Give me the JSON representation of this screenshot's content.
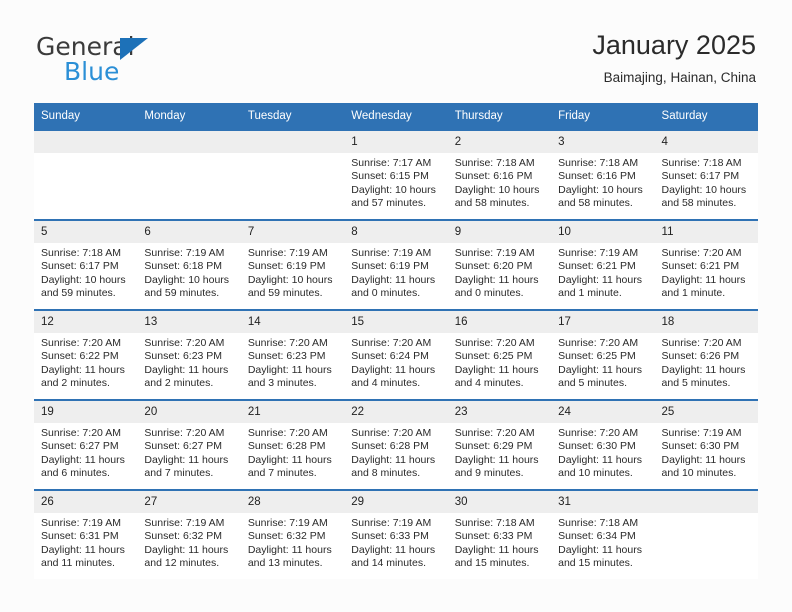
{
  "brand": {
    "name_part1": "General",
    "name_part2": "Blue",
    "accent_color": "#2b8fd6",
    "triangle_color": "#1d71b8",
    "logo_icon": "triangle-icon"
  },
  "header": {
    "title": "January 2025",
    "subtitle": "Baimajing, Hainan, China"
  },
  "theme": {
    "header_row_bg": "#2f72b4",
    "daynum_bg": "#eeeeee",
    "page_bg": "#fcfcfc",
    "text_color": "#2a2a2a"
  },
  "weekdays": [
    "Sunday",
    "Monday",
    "Tuesday",
    "Wednesday",
    "Thursday",
    "Friday",
    "Saturday"
  ],
  "labels": {
    "sunrise_prefix": "Sunrise:",
    "sunset_prefix": "Sunset:",
    "daylight_prefix": "Daylight:"
  },
  "weeks": [
    [
      {
        "day": "",
        "empty": true
      },
      {
        "day": "",
        "empty": true
      },
      {
        "day": "",
        "empty": true
      },
      {
        "day": "1",
        "sunrise": "Sunrise: 7:17 AM",
        "sunset": "Sunset: 6:15 PM",
        "daylight": "Daylight: 10 hours and 57 minutes."
      },
      {
        "day": "2",
        "sunrise": "Sunrise: 7:18 AM",
        "sunset": "Sunset: 6:16 PM",
        "daylight": "Daylight: 10 hours and 58 minutes."
      },
      {
        "day": "3",
        "sunrise": "Sunrise: 7:18 AM",
        "sunset": "Sunset: 6:16 PM",
        "daylight": "Daylight: 10 hours and 58 minutes."
      },
      {
        "day": "4",
        "sunrise": "Sunrise: 7:18 AM",
        "sunset": "Sunset: 6:17 PM",
        "daylight": "Daylight: 10 hours and 58 minutes."
      }
    ],
    [
      {
        "day": "5",
        "sunrise": "Sunrise: 7:18 AM",
        "sunset": "Sunset: 6:17 PM",
        "daylight": "Daylight: 10 hours and 59 minutes."
      },
      {
        "day": "6",
        "sunrise": "Sunrise: 7:19 AM",
        "sunset": "Sunset: 6:18 PM",
        "daylight": "Daylight: 10 hours and 59 minutes."
      },
      {
        "day": "7",
        "sunrise": "Sunrise: 7:19 AM",
        "sunset": "Sunset: 6:19 PM",
        "daylight": "Daylight: 10 hours and 59 minutes."
      },
      {
        "day": "8",
        "sunrise": "Sunrise: 7:19 AM",
        "sunset": "Sunset: 6:19 PM",
        "daylight": "Daylight: 11 hours and 0 minutes."
      },
      {
        "day": "9",
        "sunrise": "Sunrise: 7:19 AM",
        "sunset": "Sunset: 6:20 PM",
        "daylight": "Daylight: 11 hours and 0 minutes."
      },
      {
        "day": "10",
        "sunrise": "Sunrise: 7:19 AM",
        "sunset": "Sunset: 6:21 PM",
        "daylight": "Daylight: 11 hours and 1 minute."
      },
      {
        "day": "11",
        "sunrise": "Sunrise: 7:20 AM",
        "sunset": "Sunset: 6:21 PM",
        "daylight": "Daylight: 11 hours and 1 minute."
      }
    ],
    [
      {
        "day": "12",
        "sunrise": "Sunrise: 7:20 AM",
        "sunset": "Sunset: 6:22 PM",
        "daylight": "Daylight: 11 hours and 2 minutes."
      },
      {
        "day": "13",
        "sunrise": "Sunrise: 7:20 AM",
        "sunset": "Sunset: 6:23 PM",
        "daylight": "Daylight: 11 hours and 2 minutes."
      },
      {
        "day": "14",
        "sunrise": "Sunrise: 7:20 AM",
        "sunset": "Sunset: 6:23 PM",
        "daylight": "Daylight: 11 hours and 3 minutes."
      },
      {
        "day": "15",
        "sunrise": "Sunrise: 7:20 AM",
        "sunset": "Sunset: 6:24 PM",
        "daylight": "Daylight: 11 hours and 4 minutes."
      },
      {
        "day": "16",
        "sunrise": "Sunrise: 7:20 AM",
        "sunset": "Sunset: 6:25 PM",
        "daylight": "Daylight: 11 hours and 4 minutes."
      },
      {
        "day": "17",
        "sunrise": "Sunrise: 7:20 AM",
        "sunset": "Sunset: 6:25 PM",
        "daylight": "Daylight: 11 hours and 5 minutes."
      },
      {
        "day": "18",
        "sunrise": "Sunrise: 7:20 AM",
        "sunset": "Sunset: 6:26 PM",
        "daylight": "Daylight: 11 hours and 5 minutes."
      }
    ],
    [
      {
        "day": "19",
        "sunrise": "Sunrise: 7:20 AM",
        "sunset": "Sunset: 6:27 PM",
        "daylight": "Daylight: 11 hours and 6 minutes."
      },
      {
        "day": "20",
        "sunrise": "Sunrise: 7:20 AM",
        "sunset": "Sunset: 6:27 PM",
        "daylight": "Daylight: 11 hours and 7 minutes."
      },
      {
        "day": "21",
        "sunrise": "Sunrise: 7:20 AM",
        "sunset": "Sunset: 6:28 PM",
        "daylight": "Daylight: 11 hours and 7 minutes."
      },
      {
        "day": "22",
        "sunrise": "Sunrise: 7:20 AM",
        "sunset": "Sunset: 6:28 PM",
        "daylight": "Daylight: 11 hours and 8 minutes."
      },
      {
        "day": "23",
        "sunrise": "Sunrise: 7:20 AM",
        "sunset": "Sunset: 6:29 PM",
        "daylight": "Daylight: 11 hours and 9 minutes."
      },
      {
        "day": "24",
        "sunrise": "Sunrise: 7:20 AM",
        "sunset": "Sunset: 6:30 PM",
        "daylight": "Daylight: 11 hours and 10 minutes."
      },
      {
        "day": "25",
        "sunrise": "Sunrise: 7:19 AM",
        "sunset": "Sunset: 6:30 PM",
        "daylight": "Daylight: 11 hours and 10 minutes."
      }
    ],
    [
      {
        "day": "26",
        "sunrise": "Sunrise: 7:19 AM",
        "sunset": "Sunset: 6:31 PM",
        "daylight": "Daylight: 11 hours and 11 minutes."
      },
      {
        "day": "27",
        "sunrise": "Sunrise: 7:19 AM",
        "sunset": "Sunset: 6:32 PM",
        "daylight": "Daylight: 11 hours and 12 minutes."
      },
      {
        "day": "28",
        "sunrise": "Sunrise: 7:19 AM",
        "sunset": "Sunset: 6:32 PM",
        "daylight": "Daylight: 11 hours and 13 minutes."
      },
      {
        "day": "29",
        "sunrise": "Sunrise: 7:19 AM",
        "sunset": "Sunset: 6:33 PM",
        "daylight": "Daylight: 11 hours and 14 minutes."
      },
      {
        "day": "30",
        "sunrise": "Sunrise: 7:18 AM",
        "sunset": "Sunset: 6:33 PM",
        "daylight": "Daylight: 11 hours and 15 minutes."
      },
      {
        "day": "31",
        "sunrise": "Sunrise: 7:18 AM",
        "sunset": "Sunset: 6:34 PM",
        "daylight": "Daylight: 11 hours and 15 minutes."
      },
      {
        "day": "",
        "empty": true
      }
    ]
  ]
}
